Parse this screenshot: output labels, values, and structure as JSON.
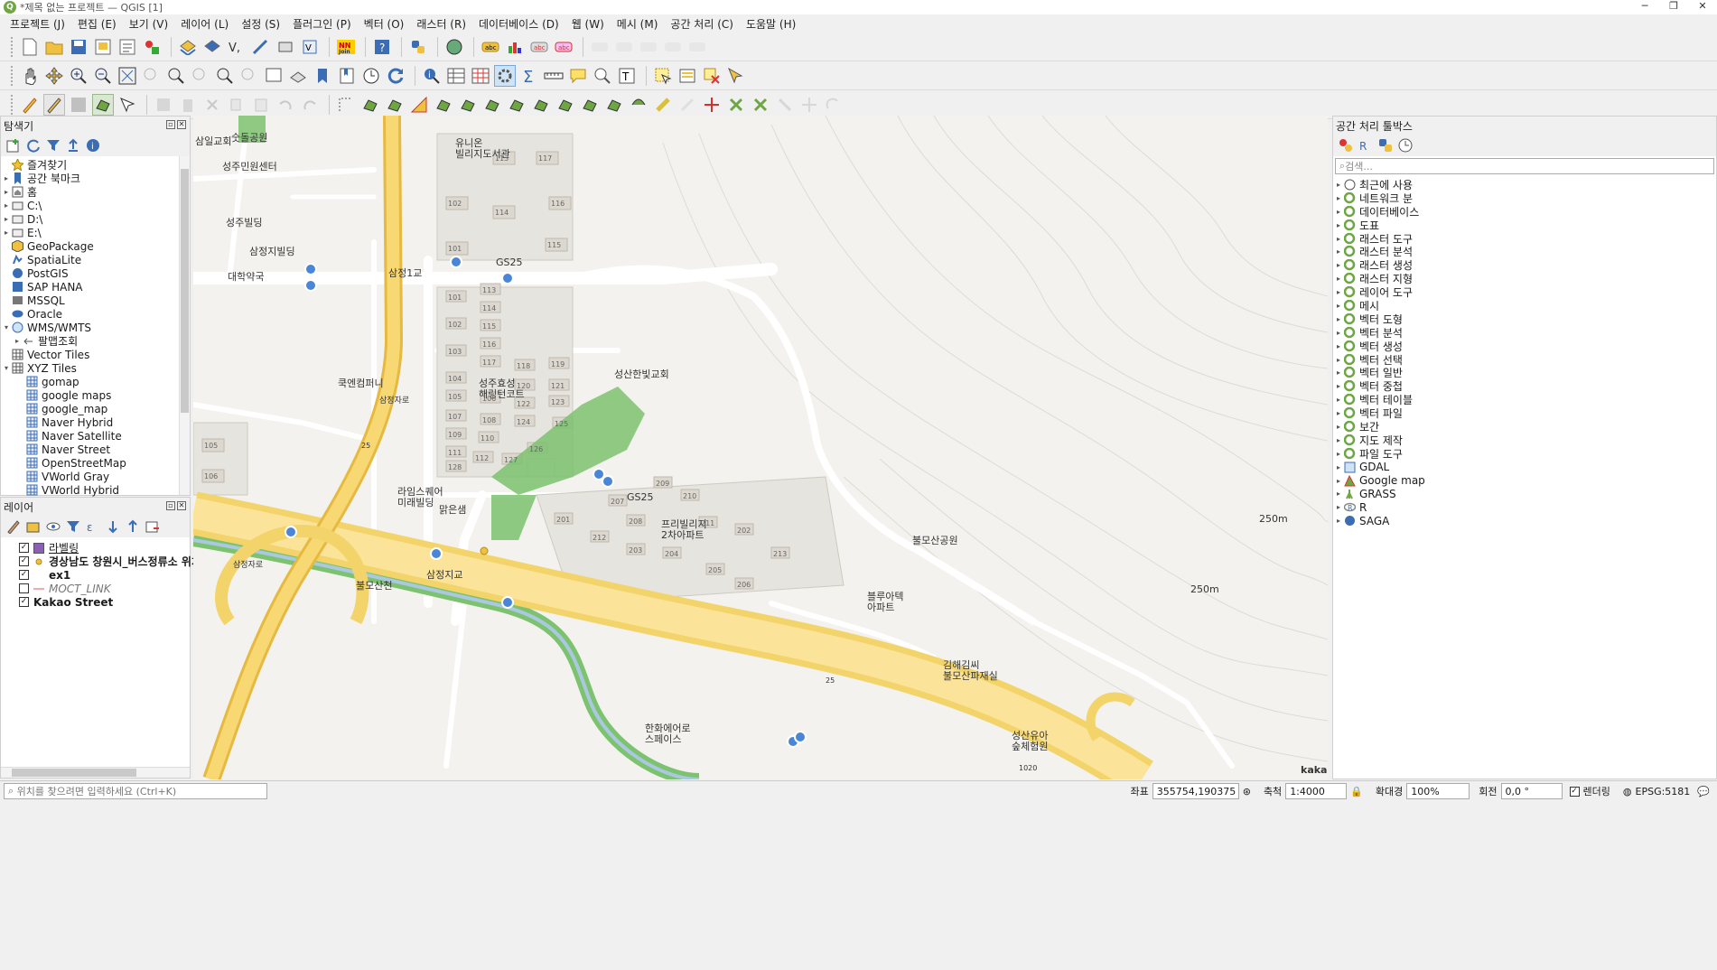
{
  "window": {
    "title": "*제목 없는 프로젝트 — QGIS [1]"
  },
  "menu": [
    "프로젝트 (J)",
    "편집 (E)",
    "보기 (V)",
    "레이어 (L)",
    "설정 (S)",
    "플러그인 (P)",
    "벡터 (O)",
    "래스터 (R)",
    "데이터베이스 (D)",
    "웹 (W)",
    "메시 (M)",
    "공간 처리 (C)",
    "도움말 (H)"
  ],
  "browser": {
    "title": "탐색기",
    "items": [
      {
        "label": "즐겨찾기",
        "icon": "star-icon"
      },
      {
        "label": "공간 북마크",
        "icon": "bookmark-icon"
      },
      {
        "label": "홈",
        "icon": "home-icon"
      },
      {
        "label": "C:\\",
        "icon": "folder-icon"
      },
      {
        "label": "D:\\",
        "icon": "folder-icon"
      },
      {
        "label": "E:\\",
        "icon": "folder-icon"
      },
      {
        "label": "GeoPackage",
        "icon": "geopackage-icon"
      },
      {
        "label": "SpatiaLite",
        "icon": "spatialite-icon"
      },
      {
        "label": "PostGIS",
        "icon": "postgis-icon"
      },
      {
        "label": "SAP HANA",
        "icon": "hana-icon"
      },
      {
        "label": "MSSQL",
        "icon": "mssql-icon"
      },
      {
        "label": "Oracle",
        "icon": "oracle-icon"
      },
      {
        "label": "WMS/WMTS",
        "icon": "globe-icon"
      },
      {
        "label": "팔맵조회",
        "icon": "wms-layer-icon"
      },
      {
        "label": "Vector Tiles",
        "icon": "grid-icon"
      },
      {
        "label": "XYZ Tiles",
        "icon": "grid-icon"
      },
      {
        "label": "gomap",
        "icon": "tile-icon"
      },
      {
        "label": "google maps",
        "icon": "tile-icon"
      },
      {
        "label": "google_map",
        "icon": "tile-icon"
      },
      {
        "label": "Naver Hybrid",
        "icon": "tile-icon"
      },
      {
        "label": "Naver Satellite",
        "icon": "tile-icon"
      },
      {
        "label": "Naver Street",
        "icon": "tile-icon"
      },
      {
        "label": "OpenStreetMap",
        "icon": "tile-icon"
      },
      {
        "label": "VWorld Gray",
        "icon": "tile-icon"
      },
      {
        "label": "VWorld Hybrid",
        "icon": "tile-icon"
      }
    ]
  },
  "layers": {
    "title": "레이어",
    "items": [
      {
        "label": "라벨링",
        "checked": true
      },
      {
        "label": "경상남도 창원시_버스정류소 위치정",
        "checked": true
      },
      {
        "label": "ex1",
        "checked": true
      },
      {
        "label": "MOCT_LINK",
        "checked": false
      },
      {
        "label": "Kakao Street",
        "checked": true
      }
    ]
  },
  "toolbox": {
    "title": "공간 처리 툴박스",
    "search_placeholder": "검색...",
    "items": [
      "최근에 사용",
      "네트워크 분",
      "데이터베이스",
      "도표",
      "래스터 도구",
      "래스터 분석",
      "래스터 생성",
      "래스터 지형",
      "레이어 도구",
      "메시",
      "벡터 도형",
      "벡터 분석",
      "벡터 생성",
      "벡터 선택",
      "벡터 일반",
      "벡터 중첩",
      "벡터 테이블",
      "벡터 파일",
      "보간",
      "지도 제작",
      "파일 도구",
      "GDAL",
      "Google map",
      "GRASS",
      "R",
      "SAGA"
    ]
  },
  "map": {
    "labels": {
      "l1": "삼일교회",
      "l2": "숫돌공원",
      "l3": "유니온\n빌리지도서관",
      "l4": "성주민원센터",
      "l5": "성주빌딩",
      "l6": "삼정지빌딩",
      "l7": "대학약국",
      "l8": "삼정1교",
      "l9": "GS25",
      "l10": "성산한빛교회",
      "l11": "쿡엔컴퍼니",
      "l12": "성주효성\n해링턴코트",
      "l13": "라임스퀘어\n미래빌딩",
      "l14": "맑은샘",
      "l15": "GS25",
      "l16": "프리빌리지\n2차아파트",
      "l17": "불모산공원",
      "l18": "블루아텍\n아파트",
      "l19": "김해김씨\n불모산파재실",
      "l20": "한화에어로\n스페이스",
      "l21": "성산유아\n숲체험원",
      "l22": "삼정지교",
      "l23": "불모산천",
      "l24": "250m",
      "l25": "250m",
      "l26": "kakao",
      "l27": "25",
      "l28": "25",
      "l29": "1020",
      "l30": "삼정자로",
      "l31": "삼정자로"
    },
    "buildings": [
      "113",
      "117",
      "102",
      "116",
      "114",
      "101",
      "115",
      "113",
      "101",
      "114",
      "102",
      "115",
      "116",
      "103",
      "117",
      "104",
      "118",
      "119",
      "105",
      "120",
      "121",
      "106",
      "122",
      "123",
      "107",
      "108",
      "124",
      "125",
      "109",
      "110",
      "126",
      "111",
      "112",
      "127",
      "128",
      "105",
      "106",
      "209",
      "210",
      "207",
      "201",
      "208",
      "211",
      "202",
      "212",
      "203",
      "204",
      "213",
      "205",
      "206"
    ]
  },
  "status": {
    "locator_placeholder": "위치를 찾으려면 입력하세요 (Ctrl+K)",
    "coord_label": "좌표",
    "coord_value": "355754,190375",
    "scale_label": "축척",
    "scale_value": "1:4000",
    "magnifier_label": "확대경",
    "magnifier_value": "100%",
    "rotation_label": "회전",
    "rotation_value": "0,0 °",
    "render_label": "렌더링",
    "crs": "EPSG:5181"
  }
}
